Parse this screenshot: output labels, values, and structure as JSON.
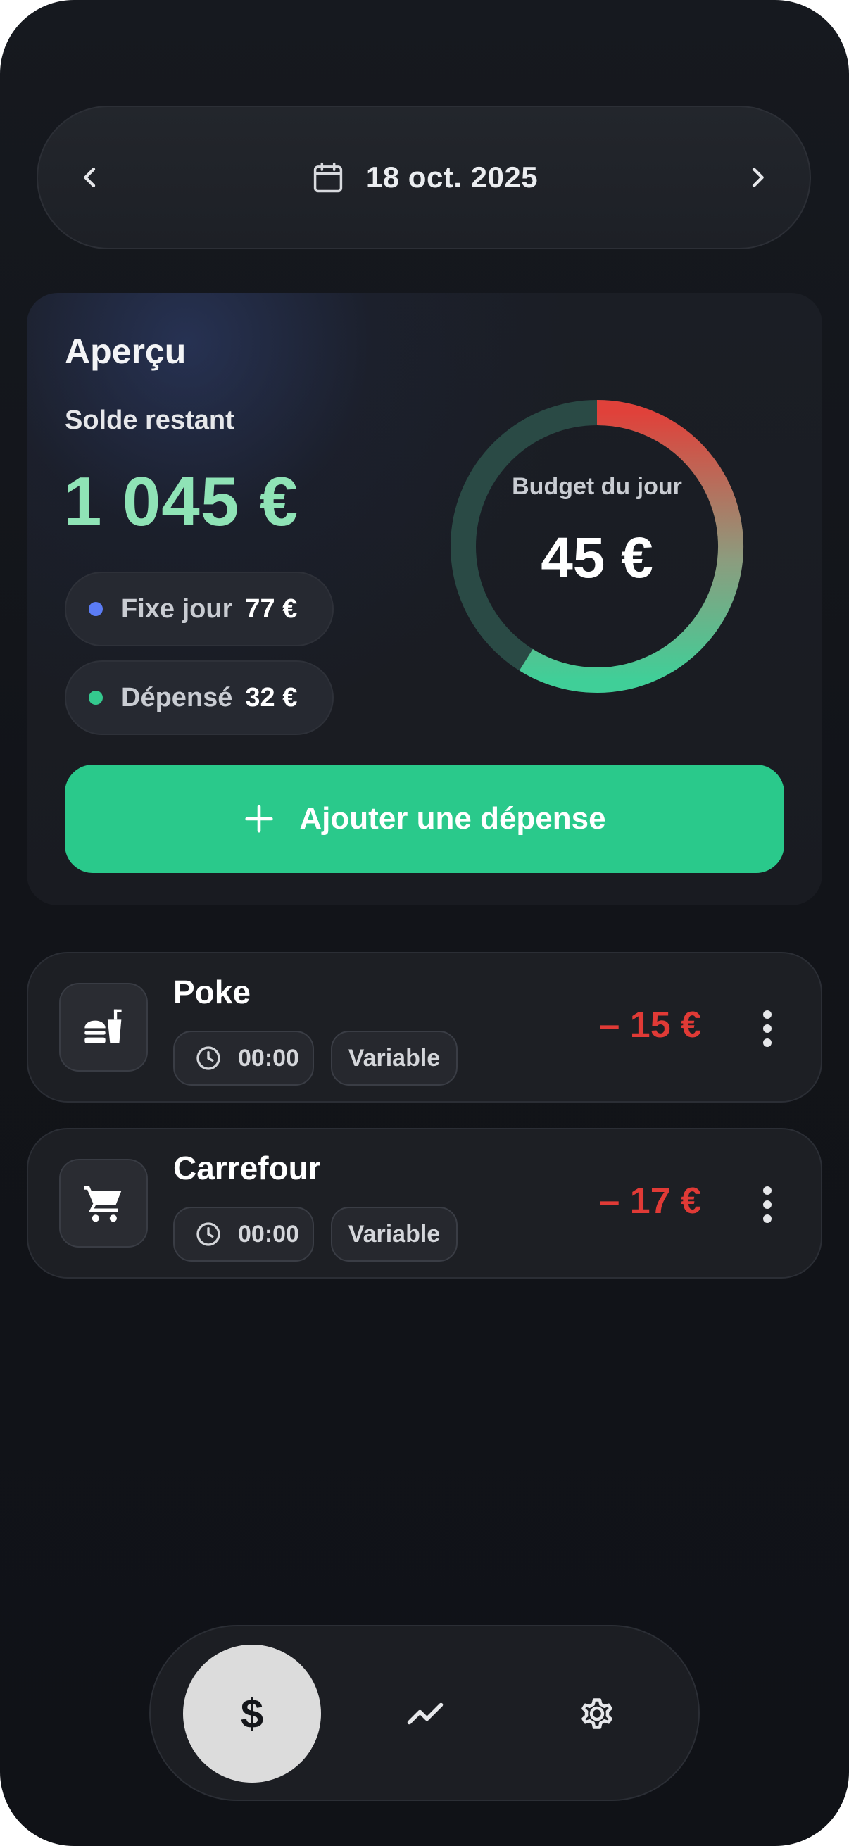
{
  "date_bar": {
    "date": "18 oct. 2025",
    "prev_icon": "chevron-left-icon",
    "next_icon": "chevron-right-icon",
    "calendar_icon": "calendar-icon"
  },
  "overview": {
    "title": "Aperçu",
    "remaining_label": "Solde restant",
    "remaining_value": "1 045 €",
    "fixed_label": "Fixe jour",
    "fixed_value": "77 €",
    "spent_label": "Dépensé",
    "spent_value": "32 €",
    "donut_label": "Budget du jour",
    "donut_value": "45 €",
    "add_button_label": "Ajouter une dépense",
    "colors": {
      "balance": "#8fe3b6",
      "fixed_dot": "#5b7cf5",
      "spent_dot": "#34c98e",
      "accent": "#2ac98b",
      "negative": "#e03a36"
    }
  },
  "expenses": [
    {
      "name": "Poke",
      "time": "00:00",
      "kind": "Variable",
      "amount": "– 15 €",
      "icon": "fastfood-icon"
    },
    {
      "name": "Carrefour",
      "time": "00:00",
      "kind": "Variable",
      "amount": "– 17 €",
      "icon": "shopping-cart-icon"
    }
  ],
  "bottom_nav": {
    "items": [
      {
        "icon": "dollar-icon",
        "glyph": "$",
        "active": true
      },
      {
        "icon": "trending-icon",
        "active": false
      },
      {
        "icon": "gear-icon",
        "active": false
      }
    ]
  }
}
